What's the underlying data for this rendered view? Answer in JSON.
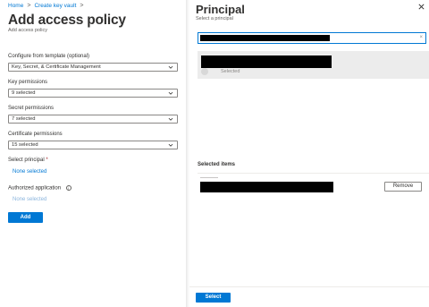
{
  "breadcrumb": {
    "home": "Home",
    "separator": ">",
    "parent": "Create key vault"
  },
  "left": {
    "title": "Add access policy",
    "more": "···",
    "subtitle": "Add access policy",
    "template_label": "Configure from template (optional)",
    "template_value": "Key, Secret, & Certificate Management",
    "key_label": "Key permissions",
    "key_value": "9 selected",
    "secret_label": "Secret permissions",
    "secret_value": "7 selected",
    "cert_label": "Certificate permissions",
    "cert_value": "15 selected",
    "principal_label": "Select principal",
    "principal_required": "*",
    "principal_link": "None selected",
    "authorized_label": "Authorized application",
    "authorized_info": "i",
    "authorized_link": "None selected",
    "add_button": "Add"
  },
  "right": {
    "title": "Principal",
    "subtitle": "Select a principal",
    "search_clear": "×",
    "result_status": "Selected",
    "selected_items_title": "Selected items",
    "remove_button": "Remove",
    "select_button": "Select"
  },
  "colors": {
    "accent": "#0078d4",
    "required": "#a4262c",
    "selected_row": "#ececec"
  },
  "icons": [
    "chevron-down-icon",
    "close-icon",
    "info-icon",
    "more-icon"
  ]
}
